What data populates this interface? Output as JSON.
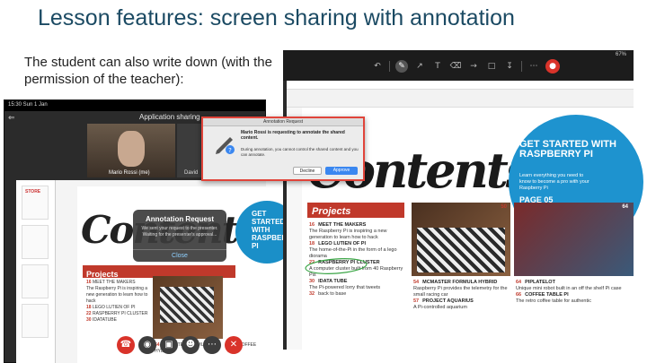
{
  "slide": {
    "title": "Lesson features: screen sharing with annotation",
    "description": "The student can also write down (with the permission of the teacher):"
  },
  "left_screenshot": {
    "status_time": "15:30 Sun 1 Jan",
    "app_title": "Application sharing",
    "video_caption_1": "Mario Rossi (me)",
    "video_caption_2": "David",
    "contents_word": "Contents",
    "projects_label": "Projects",
    "circle_text": "GET STARTED WITH RASPBERRY PI",
    "list_items": [
      {
        "num": "16",
        "text": "MEET THE MAKERS"
      },
      {
        "num": "",
        "text": "The Raspberry Pi is inspiring a new generation to learn how to hack"
      },
      {
        "num": "18",
        "text": "LEGO LUTIEN OF PI"
      },
      {
        "num": "22",
        "text": "RASPBERRY PI CLUSTER"
      },
      {
        "num": "30",
        "text": "IDATATUBE"
      },
      {
        "num": "54",
        "text": "MCMASTER FORMULA HYBRID"
      },
      {
        "num": "56",
        "text": "COFFEE"
      }
    ],
    "modal": {
      "title": "Annotation Request",
      "body": "We sent your request to the presenter. Waiting for the presenter's approval...",
      "button": "Close"
    },
    "thumb_label": "STORE"
  },
  "request_dialog": {
    "bar_title": "Annotation Request",
    "message": "Mario Rossi is requesting to annotate the shared content.",
    "detail": "During annotation, you cannot control the shared content and you can annotate.",
    "decline": "Decline",
    "approve": "Approve"
  },
  "right_screenshot": {
    "status": "67%",
    "contents_word": "Contents",
    "projects_label": "Projects",
    "circle": {
      "title": "GET STARTED WITH RASPBERRY PI",
      "subtitle": "Learn everything you need to know to become a pro with your Raspberry Pi",
      "page": "PAGE 05"
    },
    "chess_page": "50",
    "pi_page": "64",
    "col1": [
      {
        "num": "16",
        "head": "MEET THE MAKERS",
        "text": "The Raspberry Pi is inspiring a new generation to learn how to hack"
      },
      {
        "num": "18",
        "head": "LEGO LUTIEN OF PI",
        "text": "The home-of-the-Pi in the form of a lego diorama"
      },
      {
        "num": "22",
        "head": "RASPBERRY PI CLUSTER",
        "text": "A computer cluster built from 40 Raspberry Pis"
      },
      {
        "num": "30",
        "head": "IDATA TUBE",
        "text": "The Pi-powered lorry that tweets"
      },
      {
        "num": "32",
        "head": "",
        "text": "back to base"
      }
    ],
    "col2": [
      {
        "num": "54",
        "head": "MCMASTER FORMULA HYBRID",
        "text": "Raspberry Pi provides the telemetry for the small racing car"
      },
      {
        "num": "57",
        "head": "PROJECT AQUARIUS",
        "text": "A Pi-controlled aquarium"
      }
    ],
    "col3": [
      {
        "num": "64",
        "head": "PIPLATELOT",
        "text": "Unique mini robot built in an off the shelf Pi case"
      },
      {
        "num": "66",
        "head": "COFFEE TABLE PI",
        "text": "The retro coffee table for authentic"
      }
    ]
  },
  "colors": {
    "title": "#1b4a63",
    "accent_red": "#c0392b",
    "accent_blue": "#1e93cf",
    "dialog_border": "#e0443a",
    "approve": "#3a87f0"
  }
}
